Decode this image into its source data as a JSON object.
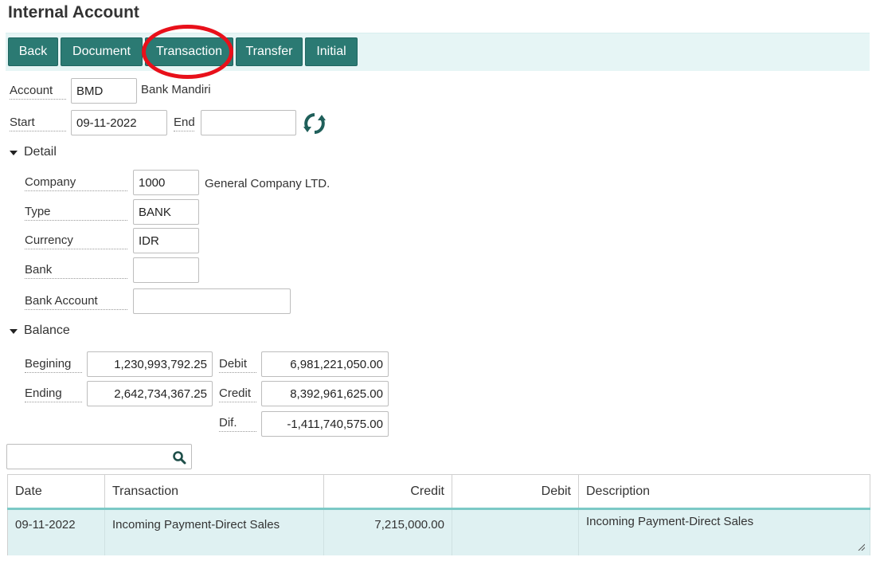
{
  "page": {
    "title": "Internal Account"
  },
  "toolbar": {
    "buttons": [
      {
        "label": "Back"
      },
      {
        "label": "Document"
      },
      {
        "label": "Transaction"
      },
      {
        "label": "Transfer"
      },
      {
        "label": "Initial"
      }
    ]
  },
  "header": {
    "account_label": "Account",
    "account_value": "BMD",
    "account_name": "Bank Mandiri",
    "start_label": "Start",
    "start_value": "09-11-2022",
    "end_label": "End",
    "end_value": ""
  },
  "detail": {
    "section_label": "Detail",
    "company_label": "Company",
    "company_value": "1000",
    "company_name": "General Company LTD.",
    "type_label": "Type",
    "type_value": "BANK",
    "currency_label": "Currency",
    "currency_value": "IDR",
    "bank_label": "Bank",
    "bank_value": "",
    "bank_account_label": "Bank Account",
    "bank_account_value": ""
  },
  "balance": {
    "section_label": "Balance",
    "begining_label": "Begining",
    "begining_value": "1,230,993,792.25",
    "ending_label": "Ending",
    "ending_value": "2,642,734,367.25",
    "debit_label": "Debit",
    "debit_value": "6,981,221,050.00",
    "credit_label": "Credit",
    "credit_value": "8,392,961,625.00",
    "dif_label": "Dif.",
    "dif_value": "-1,411,740,575.00"
  },
  "search": {
    "value": ""
  },
  "table": {
    "columns": [
      "Date",
      "Transaction",
      "Credit",
      "Debit",
      "Description"
    ],
    "rows": [
      {
        "date": "09-11-2022",
        "transaction": "Incoming Payment-Direct Sales",
        "credit": "7,215,000.00",
        "debit": "",
        "description": "Incoming Payment-Direct Sales"
      }
    ]
  },
  "colors": {
    "button_bg": "#2b7a73",
    "toolbar_bg": "#e6f5f5",
    "row_bg": "#dff1f2",
    "header_underline": "#7cc9c6",
    "annotation_circle": "#e8101a"
  },
  "icons": [
    "refresh-icon",
    "search-icon",
    "caret-down-icon",
    "resize-handle-icon"
  ]
}
